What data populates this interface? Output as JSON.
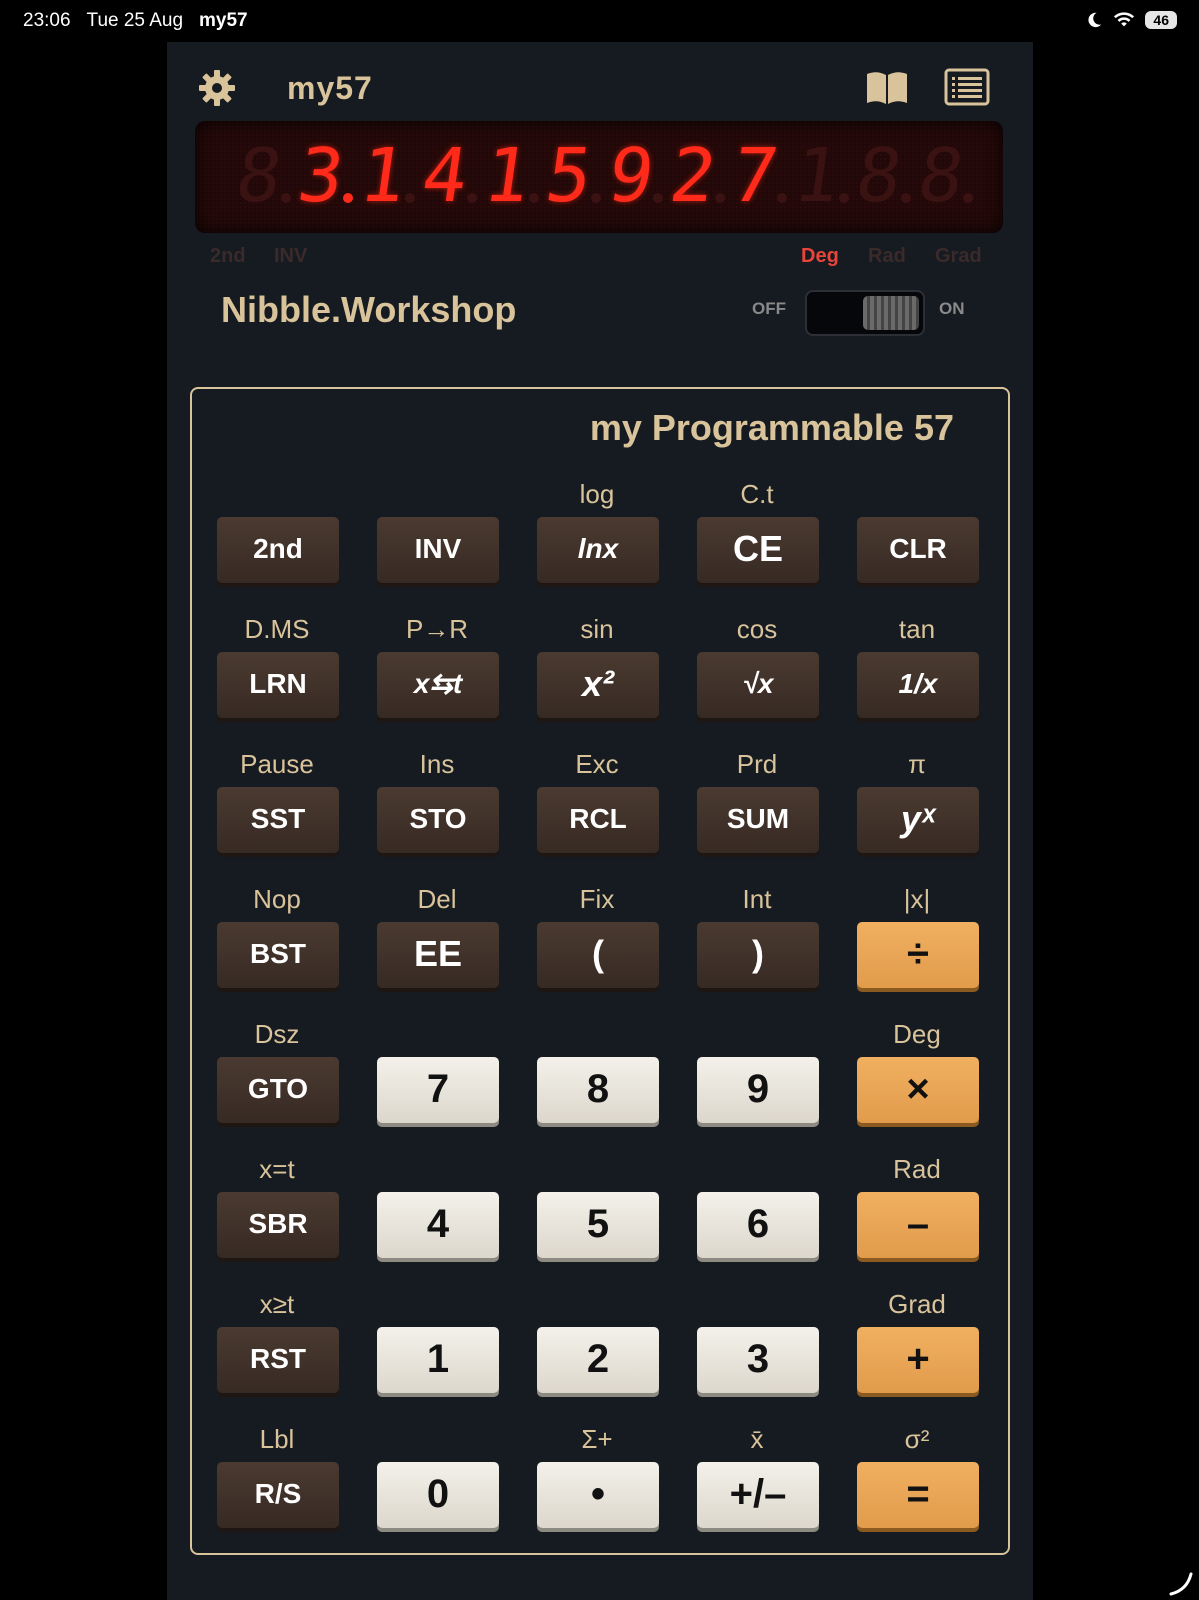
{
  "status_bar": {
    "time": "23:06",
    "date": "Tue 25 Aug",
    "app": "my57",
    "battery": "46"
  },
  "header": {
    "title": "my57",
    "settings_icon": "gear-icon",
    "manual_icon": "book-icon",
    "program_icon": "list-icon"
  },
  "display": {
    "value": "3.1415927",
    "digits": [
      {
        "ch": "8",
        "lit": false,
        "dp": false
      },
      {
        "ch": "3",
        "lit": true,
        "dp": true
      },
      {
        "ch": "1",
        "lit": true,
        "dp": false
      },
      {
        "ch": "4",
        "lit": true,
        "dp": false
      },
      {
        "ch": "1",
        "lit": true,
        "dp": false
      },
      {
        "ch": "5",
        "lit": true,
        "dp": false
      },
      {
        "ch": "9",
        "lit": true,
        "dp": false
      },
      {
        "ch": "2",
        "lit": true,
        "dp": false
      },
      {
        "ch": "7",
        "lit": true,
        "dp": false
      },
      {
        "ch": "1",
        "lit": false,
        "dp": false
      },
      {
        "ch": "8",
        "lit": false,
        "dp": false
      },
      {
        "ch": "8",
        "lit": false,
        "dp": false
      }
    ],
    "indicators": {
      "second": "2nd",
      "inv": "INV",
      "deg": "Deg",
      "rad": "Rad",
      "grad": "Grad"
    },
    "active_angle_mode": "Deg",
    "colors": {
      "lit": "#ff2a1a",
      "unlit": "#3a1212",
      "indicator_active": "#e8443a"
    }
  },
  "brand": "Nibble.Workshop",
  "power": {
    "off_label": "OFF",
    "on_label": "ON",
    "state": "on"
  },
  "keypad": {
    "model": "my Programmable 57",
    "rows": [
      [
        {
          "sec": "",
          "key": "2nd",
          "style": "dark"
        },
        {
          "sec": "",
          "key": "INV",
          "style": "dark"
        },
        {
          "sec": "log",
          "key": "lnx",
          "style": "dark ital"
        },
        {
          "sec": "C.t",
          "key": "CE",
          "style": "dark big"
        },
        {
          "sec": "",
          "key": "CLR",
          "style": "dark"
        }
      ],
      [
        {
          "sec": "D.MS",
          "key": "LRN",
          "style": "dark"
        },
        {
          "sec": "P→R",
          "key": "x⇆t",
          "style": "dark ital"
        },
        {
          "sec": "sin",
          "key": "x²",
          "style": "dark ital big"
        },
        {
          "sec": "cos",
          "key": "√x",
          "style": "dark ital"
        },
        {
          "sec": "tan",
          "key": "1/x",
          "style": "dark ital"
        }
      ],
      [
        {
          "sec": "Pause",
          "key": "SST",
          "style": "dark"
        },
        {
          "sec": "Ins",
          "key": "STO",
          "style": "dark"
        },
        {
          "sec": "Exc",
          "key": "RCL",
          "style": "dark"
        },
        {
          "sec": "Prd",
          "key": "SUM",
          "style": "dark"
        },
        {
          "sec": "π",
          "key": "yˣ",
          "style": "dark ital big"
        }
      ],
      [
        {
          "sec": "Nop",
          "key": "BST",
          "style": "dark"
        },
        {
          "sec": "Del",
          "key": "EE",
          "style": "dark big"
        },
        {
          "sec": "Fix",
          "key": "(",
          "style": "dark big"
        },
        {
          "sec": "Int",
          "key": ")",
          "style": "dark big"
        },
        {
          "sec": "|x|",
          "key": "÷",
          "style": "orange"
        }
      ],
      [
        {
          "sec": "Dsz",
          "key": "GTO",
          "style": "dark"
        },
        {
          "sec": "",
          "key": "7",
          "style": "light"
        },
        {
          "sec": "",
          "key": "8",
          "style": "light"
        },
        {
          "sec": "",
          "key": "9",
          "style": "light"
        },
        {
          "sec": "Deg",
          "key": "×",
          "style": "orange"
        }
      ],
      [
        {
          "sec": "x=t",
          "key": "SBR",
          "style": "dark"
        },
        {
          "sec": "",
          "key": "4",
          "style": "light"
        },
        {
          "sec": "",
          "key": "5",
          "style": "light"
        },
        {
          "sec": "",
          "key": "6",
          "style": "light"
        },
        {
          "sec": "Rad",
          "key": "–",
          "style": "orange"
        }
      ],
      [
        {
          "sec": "x≥t",
          "key": "RST",
          "style": "dark"
        },
        {
          "sec": "",
          "key": "1",
          "style": "light"
        },
        {
          "sec": "",
          "key": "2",
          "style": "light"
        },
        {
          "sec": "",
          "key": "3",
          "style": "light"
        },
        {
          "sec": "Grad",
          "key": "+",
          "style": "orange"
        }
      ],
      [
        {
          "sec": "Lbl",
          "key": "R/S",
          "style": "dark"
        },
        {
          "sec": "",
          "key": "0",
          "style": "light"
        },
        {
          "sec": "Σ+",
          "key": "•",
          "style": "light"
        },
        {
          "sec": "x̄",
          "key": "+/–",
          "style": "light"
        },
        {
          "sec": "σ²",
          "key": "=",
          "style": "orange"
        }
      ]
    ]
  },
  "colors": {
    "panel": "#161a21",
    "accent": "#d8c39a",
    "operator_key": "#e8a555",
    "dark_key": "#3f3029",
    "digit_key": "#ebe8e0"
  }
}
